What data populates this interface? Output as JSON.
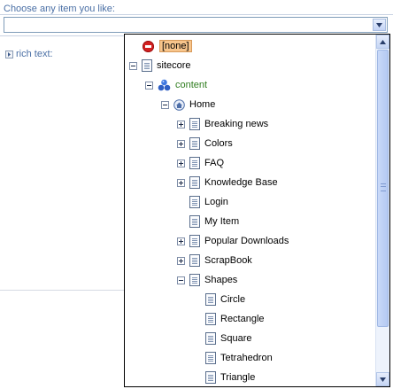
{
  "field": {
    "label": "Choose any item you like:",
    "selected_value": ""
  },
  "left_panel": {
    "rich_text_label": "rich text:"
  },
  "tree": {
    "none_label": "[none]",
    "nodes": [
      {
        "label": "sitecore",
        "expander": "minus",
        "icon": "document-icon"
      },
      {
        "label": "content",
        "expander": "minus",
        "icon": "content-icon"
      },
      {
        "label": "Home",
        "expander": "minus",
        "icon": "home-icon"
      },
      {
        "label": "Breaking news",
        "expander": "plus",
        "icon": "document-icon"
      },
      {
        "label": "Colors",
        "expander": "plus",
        "icon": "document-icon"
      },
      {
        "label": "FAQ",
        "expander": "plus",
        "icon": "document-icon"
      },
      {
        "label": "Knowledge Base",
        "expander": "plus",
        "icon": "document-icon"
      },
      {
        "label": "Login",
        "expander": "none",
        "icon": "document-icon"
      },
      {
        "label": "My Item",
        "expander": "none",
        "icon": "document-icon"
      },
      {
        "label": "Popular Downloads",
        "expander": "plus",
        "icon": "document-icon"
      },
      {
        "label": "ScrapBook",
        "expander": "plus",
        "icon": "document-icon"
      },
      {
        "label": "Shapes",
        "expander": "minus",
        "icon": "document-icon"
      },
      {
        "label": "Circle",
        "expander": "none",
        "icon": "document-icon"
      },
      {
        "label": "Rectangle",
        "expander": "none",
        "icon": "document-icon"
      },
      {
        "label": "Square",
        "expander": "none",
        "icon": "document-icon"
      },
      {
        "label": "Tetrahedron",
        "expander": "none",
        "icon": "document-icon"
      },
      {
        "label": "Triangle",
        "expander": "none",
        "icon": "document-icon"
      }
    ]
  },
  "colors": {
    "label_blue": "#4a6fa5",
    "content_green": "#2f7d1f",
    "none_highlight": "#f7c58c"
  }
}
